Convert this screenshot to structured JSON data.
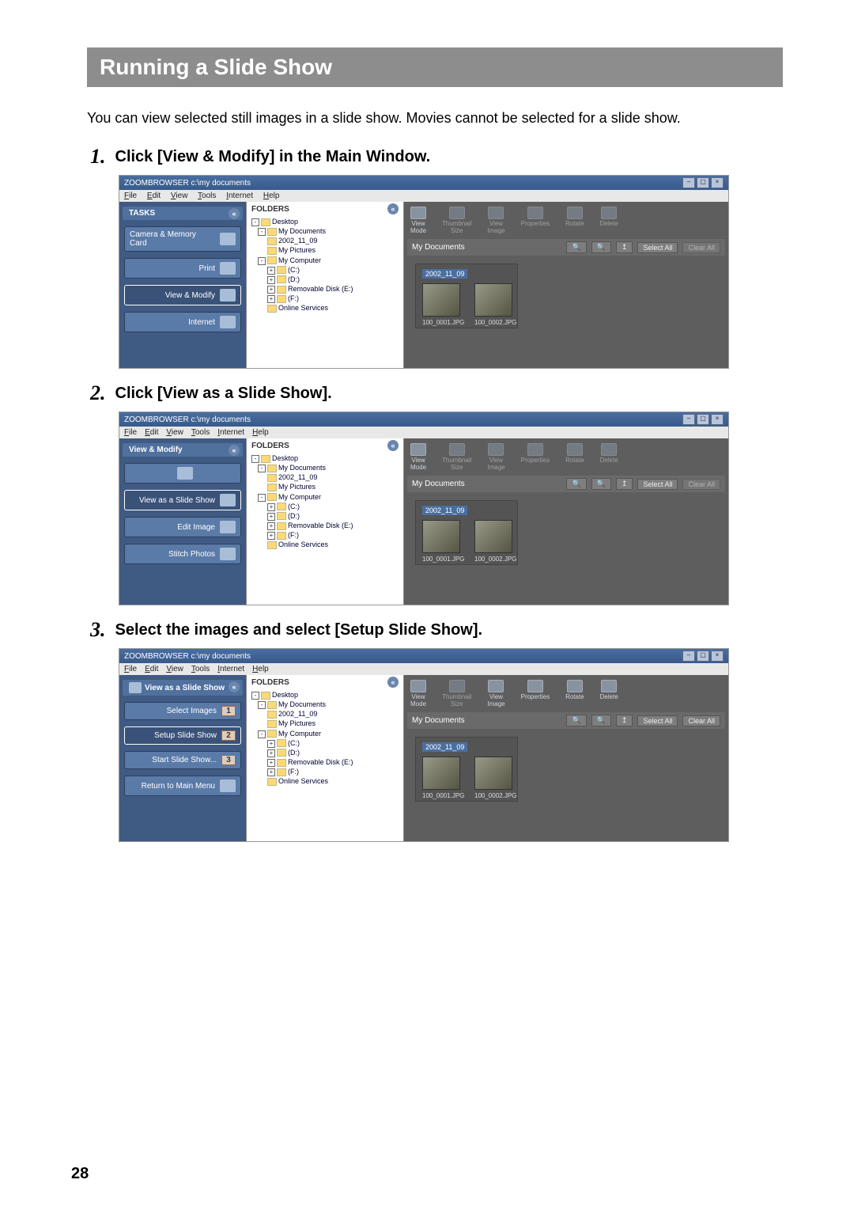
{
  "page_number": "28",
  "title": "Running a Slide Show",
  "intro": "You can view selected still images in a slide show. Movies cannot be selected for a slide show.",
  "steps": [
    {
      "num": "1.",
      "text": "Click [View & Modify] in the Main Window."
    },
    {
      "num": "2.",
      "text": "Click [View as a Slide Show]."
    },
    {
      "num": "3.",
      "text": "Select the images and select [Setup Slide Show]."
    }
  ],
  "win": {
    "title_prefix": "ZOOMBROWSER c:\\my documents",
    "menus": {
      "file": "File",
      "edit": "Edit",
      "view": "View",
      "tools": "Tools",
      "internet": "Internet",
      "help": "Help"
    },
    "folders_label": "FOLDERS",
    "folder_tree": {
      "desktop": "Desktop",
      "mydocs": "My Documents",
      "date": "2002_11_09",
      "mypics": "My Pictures",
      "mycomp": "My Computer",
      "c": "(C:)",
      "d": "(D:)",
      "e": "Removable Disk (E:)",
      "f": "(F:)",
      "online": "Online Services"
    },
    "toolbar": {
      "view": "View",
      "mode": "Mode",
      "thumb": "Thumbnail",
      "size": "Size",
      "view2": "View",
      "image": "Image",
      "prop": "Properties",
      "rotate": "Rotate",
      "delete": "Delete"
    },
    "path_label": "My Documents",
    "buttons": {
      "select_all": "Select All",
      "clear_all": "Clear All"
    },
    "group_label": "2002_11_09",
    "thumbs": [
      "100_0001.JPG",
      "100_0002.JPG"
    ]
  },
  "panel1": {
    "header": "TASKS",
    "items": [
      "Camera & Memory Card",
      "Print",
      "View & Modify",
      "Internet"
    ]
  },
  "panel2": {
    "header": "View & Modify",
    "items": [
      "View as a Slide Show",
      "Edit Image",
      "Stitch Photos"
    ]
  },
  "panel3": {
    "header": "View as a Slide Show",
    "items": [
      "Select Images",
      "Setup Slide Show",
      "Start Slide Show...",
      "Return to Main Menu"
    ],
    "badges": [
      "1",
      "2",
      "3"
    ]
  }
}
